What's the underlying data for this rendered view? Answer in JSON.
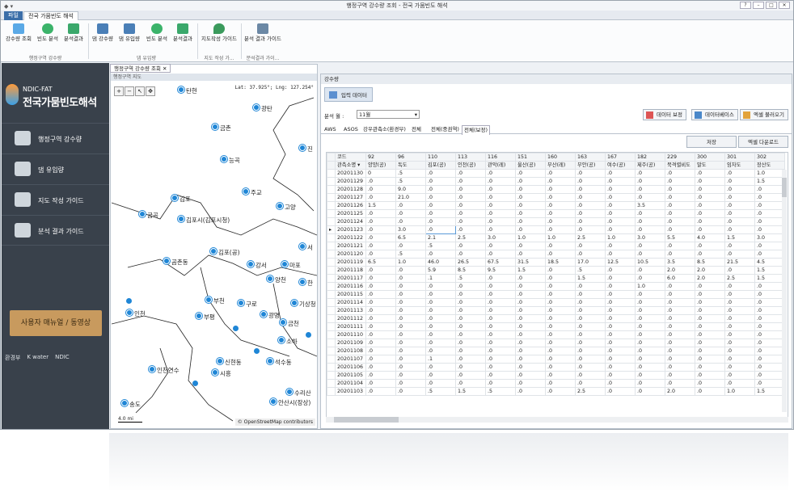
{
  "window": {
    "title": "행정구역 강수량 조회 - 전국 가뭄빈도 해석"
  },
  "ribbon": {
    "file_tab": "파일",
    "active_tab": "전국 가뭄빈도 해석",
    "buttons": [
      {
        "label": "강수량 조회",
        "icon": "cloud-rain-icon"
      },
      {
        "label": "빈도 분석",
        "icon": "play-icon"
      },
      {
        "label": "분석결과",
        "icon": "document-icon"
      },
      {
        "label": "댐 강수량",
        "icon": "dam-icon"
      },
      {
        "label": "댐 유입량",
        "icon": "dam-icon"
      },
      {
        "label": "빈도 분석",
        "icon": "play-icon"
      },
      {
        "label": "분석결과",
        "icon": "document-icon"
      },
      {
        "label": "지도작성 가이드",
        "icon": "map-pin-icon"
      },
      {
        "label": "분석 결과 가이드",
        "icon": "chart-icon"
      }
    ],
    "groups": [
      "행정구역 강수량",
      "댐 유입량",
      "지도 작성 가...",
      "분석결과 가이..."
    ]
  },
  "sidebar": {
    "logo_small": "NDIC-FAT",
    "logo_big": "전국가뭄빈도해석",
    "items": [
      {
        "label": "행정구역 강수량",
        "icon": "rain-person-icon"
      },
      {
        "label": "댐 유입량",
        "icon": "dam-icon"
      },
      {
        "label": "지도 작성 가이드",
        "icon": "map-guide-icon"
      },
      {
        "label": "분석 결과 가이드",
        "icon": "chart-guide-icon"
      }
    ],
    "manual_button": "사용자 매뉴얼 / 동영상",
    "footer_logos": [
      "환경부",
      "K water",
      "NDIC"
    ]
  },
  "map": {
    "doc_tab": "행정구역 강수량 조회",
    "caption": "행정구역 지도",
    "coord": "Lat: 37.925°; Lng: 127.254°",
    "osm": "© OpenStreetMap contributors",
    "scale": "4.0 mi",
    "places": [
      "탄현",
      "광탄",
      "금촌",
      "능곡",
      "주교",
      "김포",
      "고양",
      "금곡",
      "김포시(김포시청)",
      "김포(공)",
      "곰촌동",
      "강서",
      "마포",
      "양천",
      "한",
      "인천",
      "부천",
      "구로",
      "부평",
      "광명",
      "금천",
      "기상청",
      "소하",
      "신현동",
      "인천연수",
      "시흥",
      "석수동",
      "수리산",
      "안산시(장상)",
      "송도",
      "서",
      "진"
    ]
  },
  "data_panel": {
    "title": "강수량",
    "input_tab": "입력 데이터",
    "month_label": "분석 월 :",
    "month_value": "11월",
    "buttons": [
      "데이터 보정",
      "데이터베이스",
      "엑셀 불러오기"
    ],
    "subtabs": [
      "AWS",
      "ASOS",
      "강우관측소(환경부)",
      "전체",
      "전체(중권역)",
      "전체(보정)"
    ],
    "save_button": "저장",
    "excel_button": "엑셀 다운로드",
    "columns_code": [
      "코드",
      "92",
      "96",
      "110",
      "113",
      "116",
      "151",
      "160",
      "163",
      "167",
      "182",
      "229",
      "300",
      "301",
      "302"
    ],
    "columns_name": [
      "관측소명 ▾",
      "양양(공)",
      "독도",
      "김포(공)",
      "인천(공)",
      "관악(레)",
      "울산(공)",
      "부산(레)",
      "무안(공)",
      "여수(공)",
      "제주(공)",
      "북격렬비도",
      "말도",
      "임자도",
      "장산도"
    ],
    "rows": [
      [
        "20201130",
        "0",
        ".5",
        ".0",
        ".0",
        ".0",
        ".0",
        ".0",
        ".0",
        ".0",
        ".0",
        ".0",
        ".0",
        ".0",
        "1.0"
      ],
      [
        "20201129",
        ".0",
        ".5",
        ".0",
        ".0",
        ".0",
        ".0",
        ".0",
        ".0",
        ".0",
        ".0",
        ".0",
        ".0",
        ".0",
        "1.5"
      ],
      [
        "20201128",
        ".0",
        "9.0",
        ".0",
        ".0",
        ".0",
        ".0",
        ".0",
        ".0",
        ".0",
        ".0",
        ".0",
        ".0",
        ".0",
        ".0"
      ],
      [
        "20201127",
        ".0",
        "21.0",
        ".0",
        ".0",
        ".0",
        ".0",
        ".0",
        ".0",
        ".0",
        ".0",
        ".0",
        ".0",
        ".0",
        ".0"
      ],
      [
        "20201126",
        "1.5",
        ".0",
        ".0",
        ".0",
        ".0",
        ".0",
        ".0",
        ".0",
        ".0",
        "3.5",
        ".0",
        ".0",
        ".0",
        ".0"
      ],
      [
        "20201125",
        ".0",
        ".0",
        ".0",
        ".0",
        ".0",
        ".0",
        ".0",
        ".0",
        ".0",
        ".0",
        ".0",
        ".0",
        ".0",
        ".0"
      ],
      [
        "20201124",
        ".0",
        ".0",
        ".0",
        ".0",
        ".0",
        ".0",
        ".0",
        ".0",
        ".0",
        ".0",
        ".0",
        ".0",
        ".0",
        ".0"
      ],
      [
        "20201123",
        ".0",
        "3.0",
        ".0",
        ".0",
        ".0",
        ".0",
        ".0",
        ".0",
        ".0",
        ".0",
        ".0",
        ".0",
        ".0",
        ".0"
      ],
      [
        "20201122",
        ".0",
        "6.5",
        "2.1",
        "2.5",
        "3.0",
        "1.0",
        "1.0",
        "2.5",
        "1.0",
        "3.0",
        "5.5",
        "4.0",
        "1.5",
        "3.0"
      ],
      [
        "20201121",
        ".0",
        ".0",
        ".5",
        ".0",
        ".0",
        ".0",
        ".0",
        ".0",
        ".0",
        ".0",
        ".0",
        ".0",
        ".0",
        ".0"
      ],
      [
        "20201120",
        ".0",
        ".5",
        ".0",
        ".0",
        ".0",
        ".0",
        ".0",
        ".0",
        ".0",
        ".0",
        ".0",
        ".0",
        ".0",
        ".0"
      ],
      [
        "20201119",
        "6.5",
        "1.0",
        "46.0",
        "26.5",
        "67.5",
        "31.5",
        "18.5",
        "17.0",
        "12.5",
        "10.5",
        "3.5",
        "8.5",
        "21.5",
        "4.5"
      ],
      [
        "20201118",
        ".0",
        ".0",
        "5.9",
        "8.5",
        "9.5",
        "1.5",
        ".0",
        ".5",
        ".0",
        ".0",
        "2.0",
        "2.0",
        ".0",
        "1.5"
      ],
      [
        "20201117",
        ".0",
        ".0",
        ".1",
        ".5",
        ".0",
        ".0",
        ".0",
        "1.5",
        ".0",
        ".0",
        "6.0",
        "2.0",
        "2.5",
        "1.5"
      ],
      [
        "20201116",
        ".0",
        ".0",
        ".0",
        ".0",
        ".0",
        ".0",
        ".0",
        ".0",
        ".0",
        "1.0",
        ".0",
        ".0",
        ".0",
        ".0"
      ],
      [
        "20201115",
        ".0",
        ".0",
        ".0",
        ".0",
        ".0",
        ".0",
        ".0",
        ".0",
        ".0",
        ".0",
        ".0",
        ".0",
        ".0",
        ".0"
      ],
      [
        "20201114",
        ".0",
        ".0",
        ".0",
        ".0",
        ".0",
        ".0",
        ".0",
        ".0",
        ".0",
        ".0",
        ".0",
        ".0",
        ".0",
        ".0"
      ],
      [
        "20201113",
        ".0",
        ".0",
        ".0",
        ".0",
        ".0",
        ".0",
        ".0",
        ".0",
        ".0",
        ".0",
        ".0",
        ".0",
        ".0",
        ".0"
      ],
      [
        "20201112",
        ".0",
        ".0",
        ".0",
        ".0",
        ".0",
        ".0",
        ".0",
        ".0",
        ".0",
        ".0",
        ".0",
        ".0",
        ".0",
        ".0"
      ],
      [
        "20201111",
        ".0",
        ".0",
        ".0",
        ".0",
        ".0",
        ".0",
        ".0",
        ".0",
        ".0",
        ".0",
        ".0",
        ".0",
        ".0",
        ".0"
      ],
      [
        "20201110",
        ".0",
        ".0",
        ".0",
        ".0",
        ".0",
        ".0",
        ".0",
        ".0",
        ".0",
        ".0",
        ".0",
        ".0",
        ".0",
        ".0"
      ],
      [
        "20201109",
        ".0",
        ".0",
        ".0",
        ".0",
        ".0",
        ".0",
        ".0",
        ".0",
        ".0",
        ".0",
        ".0",
        ".0",
        ".0",
        ".0"
      ],
      [
        "20201108",
        ".0",
        ".0",
        ".0",
        ".0",
        ".0",
        ".0",
        ".0",
        ".0",
        ".0",
        ".0",
        ".0",
        ".0",
        ".0",
        ".0"
      ],
      [
        "20201107",
        ".0",
        ".0",
        ".1",
        ".0",
        ".0",
        ".0",
        ".0",
        ".0",
        ".0",
        ".0",
        ".0",
        ".0",
        ".0",
        ".0"
      ],
      [
        "20201106",
        ".0",
        ".0",
        ".0",
        ".0",
        ".0",
        ".0",
        ".0",
        ".0",
        ".0",
        ".0",
        ".0",
        ".0",
        ".0",
        ".0"
      ],
      [
        "20201105",
        ".0",
        ".0",
        ".0",
        ".0",
        ".0",
        ".0",
        ".0",
        ".0",
        ".0",
        ".0",
        ".0",
        ".0",
        ".0",
        ".0"
      ],
      [
        "20201104",
        ".0",
        ".0",
        ".0",
        ".0",
        ".0",
        ".0",
        ".0",
        ".0",
        ".0",
        ".0",
        ".0",
        ".0",
        ".0",
        ".0"
      ],
      [
        "20201103",
        ".0",
        ".0",
        ".5",
        "1.5",
        ".5",
        ".0",
        ".0",
        "2.5",
        ".0",
        ".0",
        "2.0",
        ".0",
        "1.0",
        "1.5"
      ]
    ],
    "selected_row": "20201123"
  }
}
